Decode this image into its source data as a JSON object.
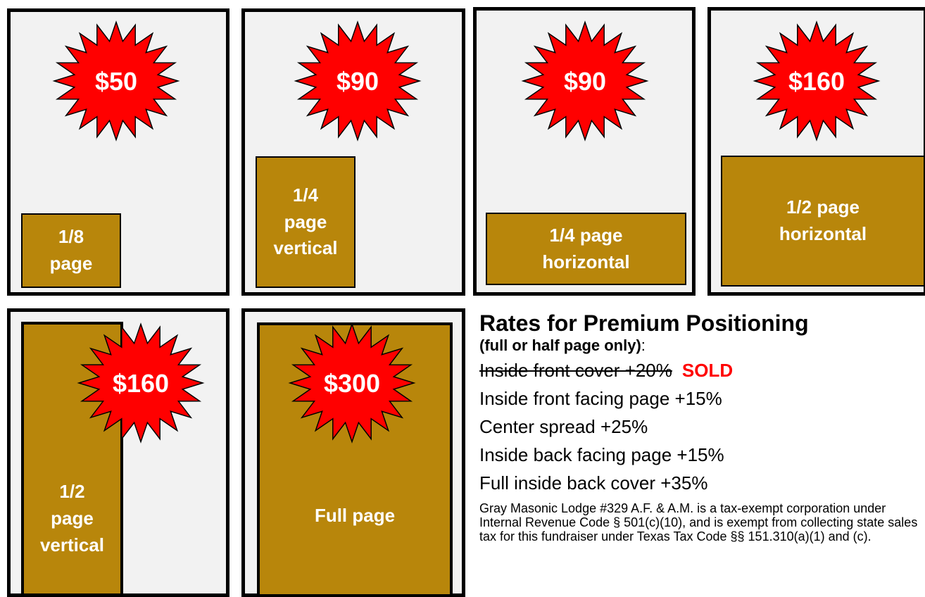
{
  "ads": [
    {
      "price": "$50",
      "size_lines": [
        "1/8",
        "page"
      ]
    },
    {
      "price": "$90",
      "size_lines": [
        "1/4",
        "page",
        "vertical"
      ]
    },
    {
      "price": "$90",
      "size_lines": [
        "1/4 page",
        "horizontal"
      ]
    },
    {
      "price": "$160",
      "size_lines": [
        "1/2 page",
        "horizontal"
      ]
    },
    {
      "price": "$160",
      "size_lines": [
        "1/2",
        "page",
        "vertical"
      ]
    },
    {
      "price": "$300",
      "size_lines": [
        "Full page"
      ]
    }
  ],
  "premium": {
    "title": "Rates for Premium Positioning",
    "subtitle_bold": "(full or half page only)",
    "subtitle_tail": ":",
    "items": [
      {
        "text": "Inside front cover +20%",
        "struck": true,
        "status": "SOLD"
      },
      {
        "text": "Inside front facing page +15%"
      },
      {
        "text": "Center spread +25%"
      },
      {
        "text": "Inside back facing page +15%"
      },
      {
        "text": "Full inside back cover +35%"
      }
    ],
    "note": "Gray Masonic Lodge #329 A.F. & A.M. is a tax-exempt corporation under Internal Revenue Code § 501(c)(10), and is exempt from collecting state sales tax for this fundraiser under Texas Tax Code §§ 151.310(a)(1) and (c)."
  },
  "colors": {
    "burst": "#ff0000",
    "ad_box": "#b8860b",
    "panel": "#f2f2f2",
    "sold": "#ff0000"
  }
}
